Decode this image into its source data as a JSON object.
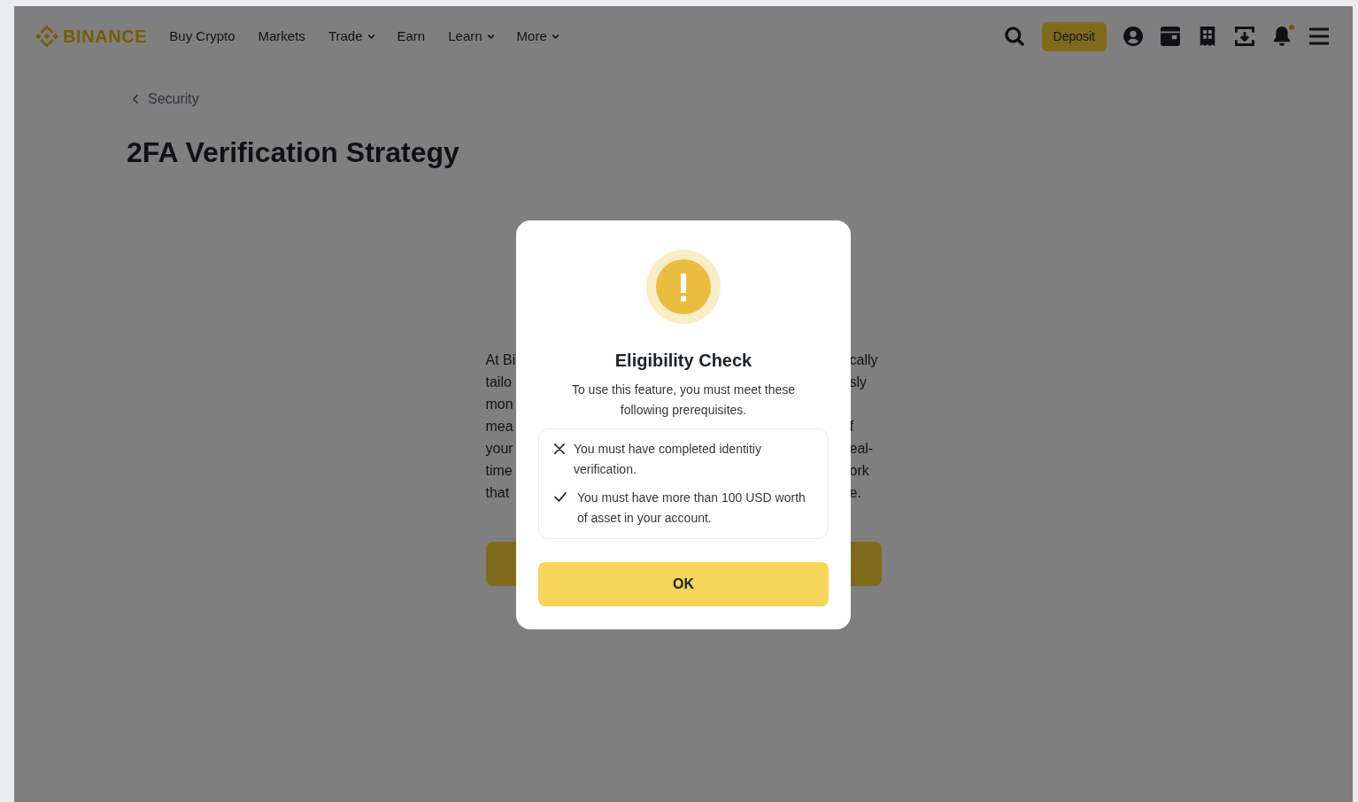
{
  "header": {
    "logo": "BINANCE",
    "nav": [
      {
        "label": "Buy Crypto",
        "has_menu": false
      },
      {
        "label": "Markets",
        "has_menu": false
      },
      {
        "label": "Trade",
        "has_menu": true
      },
      {
        "label": "Earn",
        "has_menu": false
      },
      {
        "label": "Learn",
        "has_menu": true
      },
      {
        "label": "More",
        "has_menu": true
      }
    ],
    "deposit_button": "Deposit",
    "icons": [
      {
        "kind": "search",
        "badge": false
      },
      {
        "kind": "account",
        "badge": false
      },
      {
        "kind": "wallet",
        "badge": false
      },
      {
        "kind": "orders",
        "badge": false
      },
      {
        "kind": "download",
        "badge": false
      },
      {
        "kind": "notifications",
        "badge": true
      },
      {
        "kind": "menu",
        "badge": false
      }
    ]
  },
  "breadcrumb": {
    "label": "Security"
  },
  "page_title": "2FA Verification Strategy",
  "background_text": {
    "lines": [
      {
        "left": "At Bi",
        "right": "cally"
      },
      {
        "left": "tailo",
        "right": "sly"
      },
      {
        "left": "mon"
      },
      {
        "left": "mea",
        "right": "f"
      },
      {
        "left": "your",
        "right": "eal-"
      },
      {
        "left": "time",
        "right": "ork"
      },
      {
        "left": "that",
        "right": "e."
      }
    ]
  },
  "dialog": {
    "title": "Eligibility Check",
    "message": "To use this feature, you must meet these following prerequisites.",
    "requirements": [
      {
        "text": "You must have completed identitiy verification.",
        "met": false
      },
      {
        "text": "You must have more than 100 USD worth of asset in your account.",
        "met": true
      }
    ],
    "button": "OK"
  }
}
